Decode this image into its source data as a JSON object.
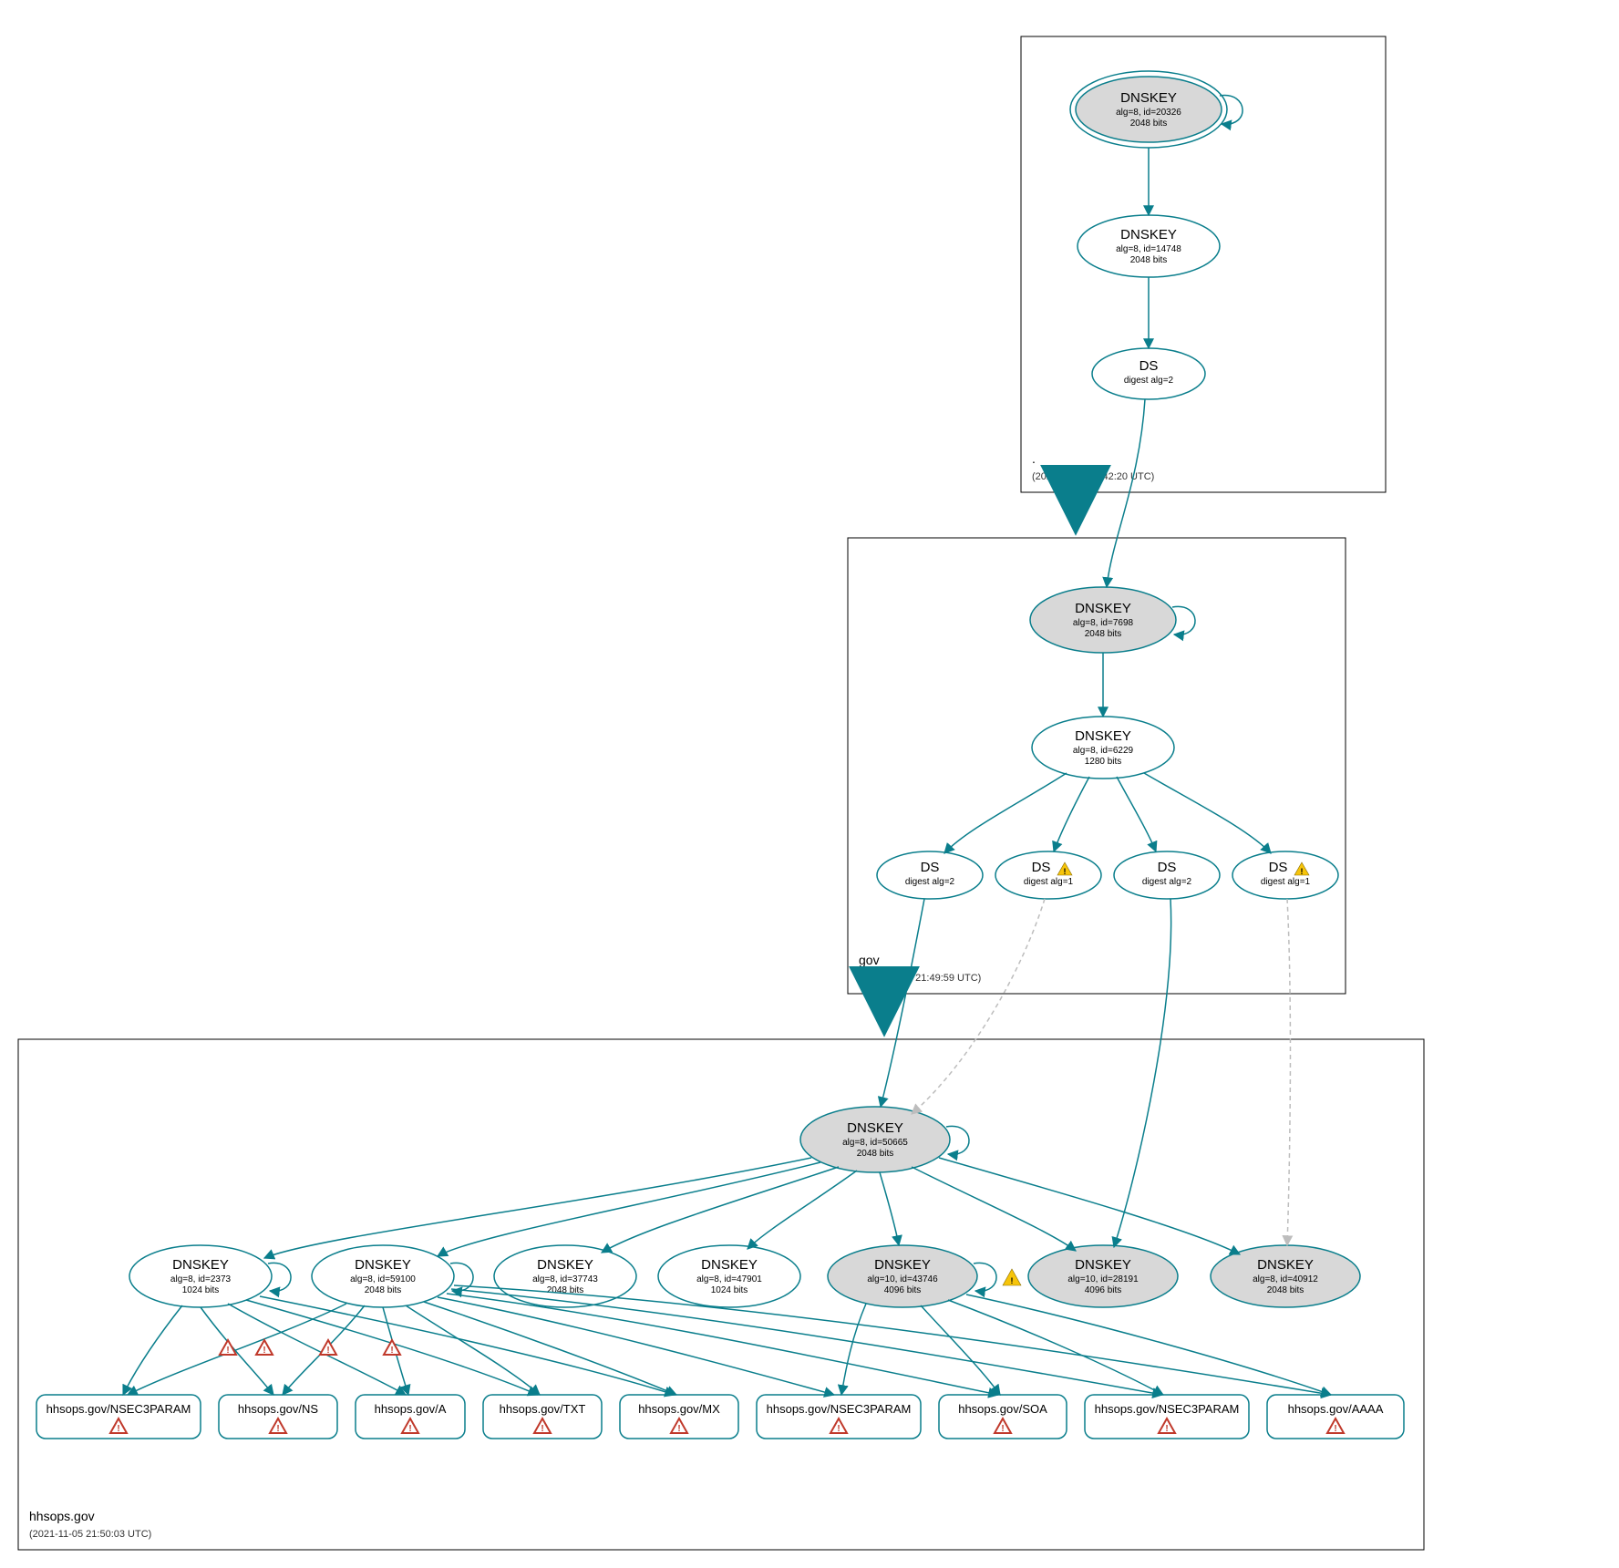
{
  "zones": {
    "root": {
      "name": ".",
      "timestamp": "(2021-11-05 20:42:20 UTC)"
    },
    "gov": {
      "name": "gov",
      "timestamp": "(2021-11-05 21:49:59 UTC)"
    },
    "hhs": {
      "name": "hhsops.gov",
      "timestamp": "(2021-11-05 21:50:03 UTC)"
    }
  },
  "nodes": {
    "root_ksk": {
      "title": "DNSKEY",
      "l1": "alg=8, id=20326",
      "l2": "2048 bits"
    },
    "root_zsk": {
      "title": "DNSKEY",
      "l1": "alg=8, id=14748",
      "l2": "2048 bits"
    },
    "root_ds": {
      "title": "DS",
      "l1": "digest alg=2"
    },
    "gov_ksk": {
      "title": "DNSKEY",
      "l1": "alg=8, id=7698",
      "l2": "2048 bits"
    },
    "gov_zsk": {
      "title": "DNSKEY",
      "l1": "alg=8, id=6229",
      "l2": "1280 bits"
    },
    "gov_ds1": {
      "title": "DS",
      "l1": "digest alg=2"
    },
    "gov_ds2": {
      "title": "DS",
      "l1": "digest alg=1"
    },
    "gov_ds3": {
      "title": "DS",
      "l1": "digest alg=2"
    },
    "gov_ds4": {
      "title": "DS",
      "l1": "digest alg=1"
    },
    "hhs_ksk": {
      "title": "DNSKEY",
      "l1": "alg=8, id=50665",
      "l2": "2048 bits"
    },
    "hhs_k1": {
      "title": "DNSKEY",
      "l1": "alg=8, id=2373",
      "l2": "1024 bits"
    },
    "hhs_k2": {
      "title": "DNSKEY",
      "l1": "alg=8, id=59100",
      "l2": "2048 bits"
    },
    "hhs_k3": {
      "title": "DNSKEY",
      "l1": "alg=8, id=37743",
      "l2": "2048 bits"
    },
    "hhs_k4": {
      "title": "DNSKEY",
      "l1": "alg=8, id=47901",
      "l2": "1024 bits"
    },
    "hhs_k5": {
      "title": "DNSKEY",
      "l1": "alg=10, id=43746",
      "l2": "4096 bits"
    },
    "hhs_k6": {
      "title": "DNSKEY",
      "l1": "alg=10, id=28191",
      "l2": "4096 bits"
    },
    "hhs_k7": {
      "title": "DNSKEY",
      "l1": "alg=8, id=40912",
      "l2": "2048 bits"
    },
    "rec_nsec3a": {
      "title": "hhsops.gov/NSEC3PARAM"
    },
    "rec_ns": {
      "title": "hhsops.gov/NS"
    },
    "rec_a": {
      "title": "hhsops.gov/A"
    },
    "rec_txt": {
      "title": "hhsops.gov/TXT"
    },
    "rec_mx": {
      "title": "hhsops.gov/MX"
    },
    "rec_nsec3b": {
      "title": "hhsops.gov/NSEC3PARAM"
    },
    "rec_soa": {
      "title": "hhsops.gov/SOA"
    },
    "rec_nsec3c": {
      "title": "hhsops.gov/NSEC3PARAM"
    },
    "rec_aaaa": {
      "title": "hhsops.gov/AAAA"
    }
  }
}
